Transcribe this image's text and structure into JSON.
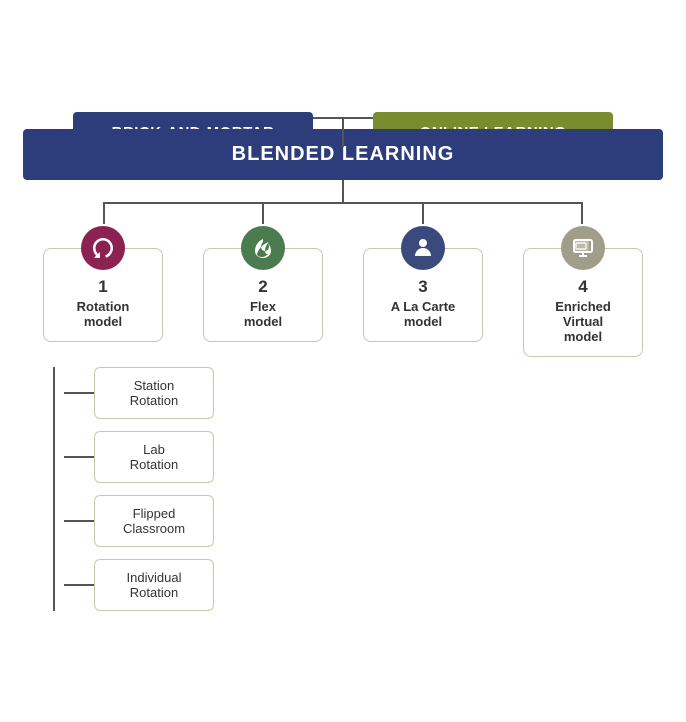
{
  "header": {
    "brick_label": "BRICK-AND-MORTAR",
    "online_label": "ONLINE LEARNING",
    "blended_label": "BLENDED LEARNING"
  },
  "models": [
    {
      "id": "rotation",
      "num": "1",
      "name": "Rotation\nmodel",
      "icon": "↺",
      "icon_class": "icon-rotation",
      "icon_label": "rotation-icon"
    },
    {
      "id": "flex",
      "num": "2",
      "name": "Flex\nmodel",
      "icon": "𝒻",
      "icon_class": "icon-flex",
      "icon_label": "flex-icon"
    },
    {
      "id": "alacarte",
      "num": "3",
      "name": "A La Carte\nmodel",
      "icon": "👤",
      "icon_class": "icon-alacarte",
      "icon_label": "alacarte-icon"
    },
    {
      "id": "enriched",
      "num": "4",
      "name": "Enriched\nVirtual\nmodel",
      "icon": "🖥",
      "icon_class": "icon-enriched",
      "icon_label": "enriched-icon"
    }
  ],
  "sub_items": [
    {
      "label": "Station\nRotation"
    },
    {
      "label": "Lab\nRotation"
    },
    {
      "label": "Flipped\nClassroom"
    },
    {
      "label": "Individual\nRotation"
    }
  ],
  "colors": {
    "brick_bg": "#2d3d7c",
    "online_bg": "#7a8c2e",
    "blended_bg": "#2d3d7c",
    "box_border": "#c8c8a8",
    "connector": "#555555",
    "rotation_icon": "#8b2252",
    "flex_icon": "#4a7c4e",
    "alacarte_icon": "#3a4a7c",
    "enriched_icon": "#9e9e8a"
  }
}
